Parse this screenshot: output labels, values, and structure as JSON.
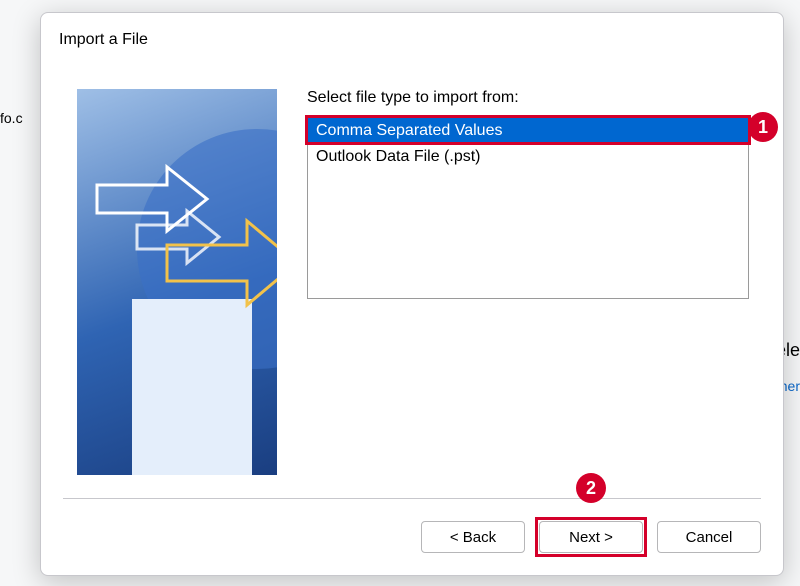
{
  "background": {
    "left_fragment": "fo.c",
    "right_fragment_1": "ele",
    "right_fragment_2": "her"
  },
  "dialog": {
    "title": "Import a File",
    "instruction": "Select file type to import from:",
    "file_types": {
      "selected": "Comma Separated Values",
      "other": "Outlook Data File (.pst)"
    },
    "annotations": {
      "badge1": "1",
      "badge2": "2"
    },
    "buttons": {
      "back": "< Back",
      "next": "Next >",
      "cancel": "Cancel"
    }
  }
}
